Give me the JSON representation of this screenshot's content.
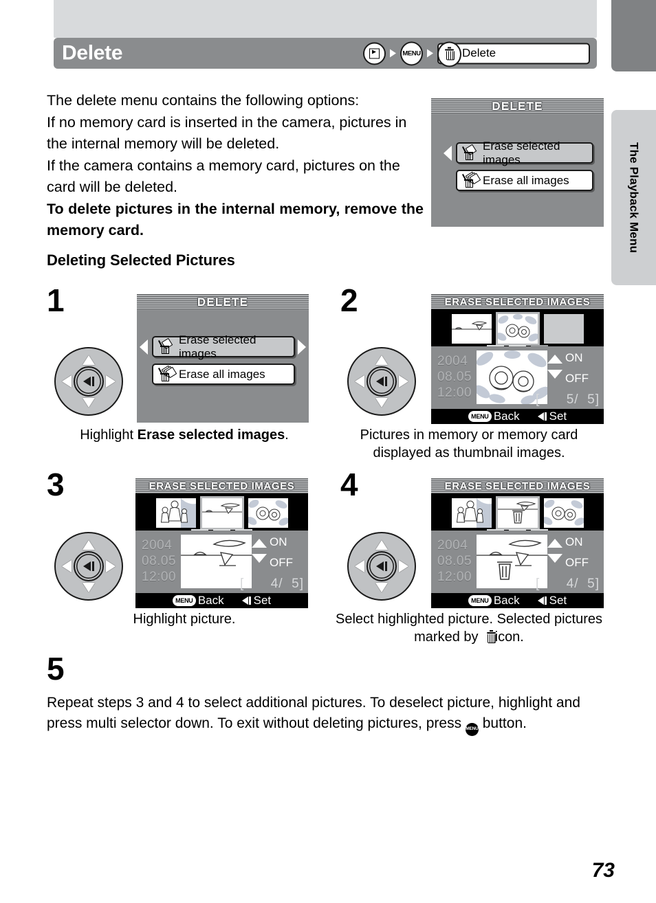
{
  "header": {
    "title": "Delete",
    "breadcrumb": {
      "play_icon": "playback-icon",
      "menu_label": "MENU",
      "target_label": "Delete",
      "target_icon": "trash-icon"
    }
  },
  "side_tab": {
    "label": "The Playback Menu"
  },
  "intro": {
    "line1": "The delete menu contains the following options:",
    "line2": "If no memory card is inserted in the camera, pictures in the internal memory will be deleted.",
    "line3": "If the camera contains a memory card, pictures on the card will be deleted.",
    "bold": "To delete pictures in the internal memory, remove the memory card."
  },
  "delete_screen": {
    "title": "DELETE",
    "options": [
      {
        "label": "Erase selected images",
        "icon": "erase-selected-icon",
        "selected": true
      },
      {
        "label": "Erase all images",
        "icon": "erase-all-icon",
        "selected": false
      }
    ]
  },
  "section_heading": "Deleting Selected Pictures",
  "steps": [
    {
      "number": "1",
      "caption_prefix": "Highlight ",
      "caption_bold": "Erase selected images",
      "caption_suffix": ".",
      "screen_title": "DELETE"
    },
    {
      "number": "2",
      "caption": "Pictures in memory or memory card displayed as thumbnail images.",
      "screen_title": "ERASE SELECTED IMAGES",
      "date": "2004",
      "date2": "08.05",
      "time": "12:00",
      "on_label": "ON",
      "off_label": "OFF",
      "counter_current": "5",
      "counter_total": "5",
      "back_chip": "MENU",
      "back_label": "Back",
      "set_label": "Set"
    },
    {
      "number": "3",
      "caption": "Highlight picture.",
      "screen_title": "ERASE SELECTED IMAGES",
      "date": "2004",
      "date2": "08.05",
      "time": "12:00",
      "on_label": "ON",
      "off_label": "OFF",
      "counter_current": "4",
      "counter_total": "5",
      "back_chip": "MENU",
      "back_label": "Back",
      "set_label": "Set"
    },
    {
      "number": "4",
      "caption_part1": "Select highlighted picture. Selected pictures marked by ",
      "caption_part2": " icon.",
      "screen_title": "ERASE SELECTED IMAGES",
      "date": "2004",
      "date2": "08.05",
      "time": "12:00",
      "on_label": "ON",
      "off_label": "OFF",
      "counter_current": "4",
      "counter_total": "5",
      "back_chip": "MENU",
      "back_label": "Back",
      "set_label": "Set"
    },
    {
      "number": "5",
      "text_part1": "Repeat steps 3 and 4 to select additional pictures. To deselect picture, highlight and press multi selector down. To exit without deleting pictures, press ",
      "text_part2": " button.",
      "inline_menu": "MENU"
    }
  ],
  "page_number": "73",
  "colors": {
    "header_bar": "#8a8c8e",
    "header_band": "#d8dadc",
    "side_tab": "#cdcfd1",
    "side_tab_top": "#808284",
    "lcd_bg": "#8a8c8e",
    "lcd_black": "#000000",
    "selected_row": "#c6c8ca"
  }
}
